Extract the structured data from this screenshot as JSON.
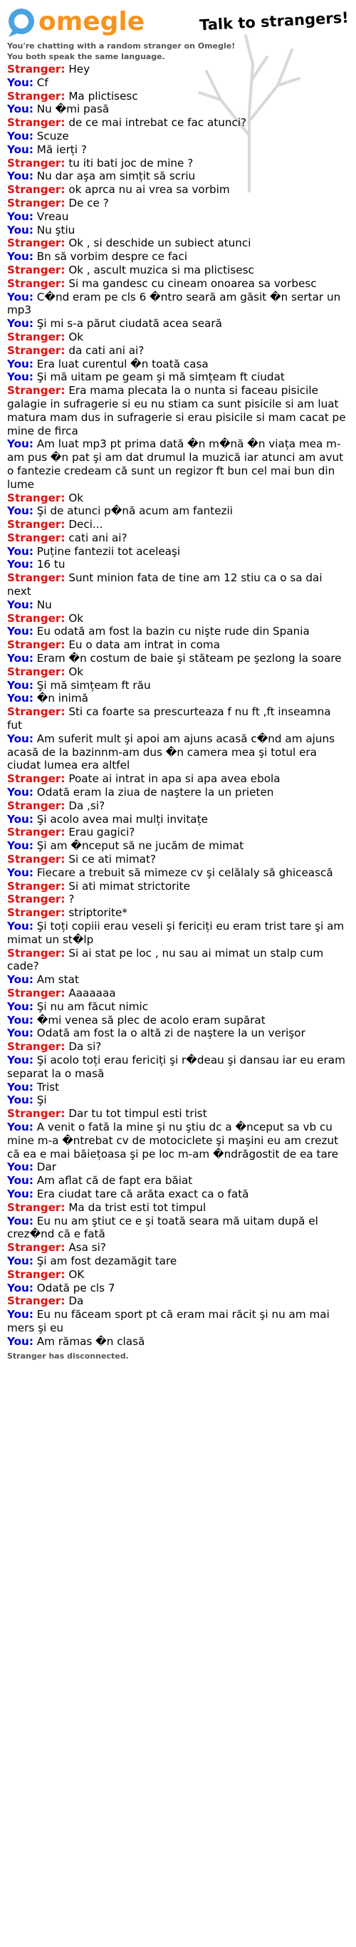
{
  "app": {
    "logo_text": "omegle",
    "tagline": "Talk to strangers!",
    "status_line1": "You're chatting with a random stranger on Omegle!",
    "status_line2": "You both speak the same language.",
    "disconnected": "Stranger has disconnected.",
    "colors": {
      "brand_orange": "#f7931e",
      "logo_blue": "#4aa3df",
      "stranger": "#dd1111",
      "you": "#0000d6"
    }
  },
  "speakers": {
    "stranger": "Stranger:",
    "you": "You:"
  },
  "messages": [
    {
      "from": "stranger",
      "text": "Hey"
    },
    {
      "from": "you",
      "text": "Cf"
    },
    {
      "from": "stranger",
      "text": "Ma plictisesc"
    },
    {
      "from": "you",
      "text": "Nu �mi pasă"
    },
    {
      "from": "stranger",
      "text": "de ce mai intrebat ce fac atunci?"
    },
    {
      "from": "you",
      "text": "Scuze"
    },
    {
      "from": "you",
      "text": "Mă ierți ?"
    },
    {
      "from": "stranger",
      "text": "tu iti bati joc de mine ?"
    },
    {
      "from": "you",
      "text": "Nu dar aşa am simțit să scriu"
    },
    {
      "from": "stranger",
      "text": "ok aprca nu ai vrea sa vorbim"
    },
    {
      "from": "stranger",
      "text": "De ce ?"
    },
    {
      "from": "you",
      "text": "Vreau"
    },
    {
      "from": "you",
      "text": "Nu ştiu"
    },
    {
      "from": "stranger",
      "text": "Ok , si deschide un subiect atunci"
    },
    {
      "from": "you",
      "text": "Bn să vorbim despre ce faci"
    },
    {
      "from": "stranger",
      "text": "Ok , ascult muzica si ma plictisesc"
    },
    {
      "from": "stranger",
      "text": "Si ma gandesc cu cineam onoarea sa vorbesc"
    },
    {
      "from": "you",
      "text": "C�nd eram pe cls 6 �ntro seară am găsit �n sertar un mp3"
    },
    {
      "from": "you",
      "text": "Şi mi s-a părut ciudată acea seară"
    },
    {
      "from": "stranger",
      "text": "Ok"
    },
    {
      "from": "stranger",
      "text": "da cati ani ai?"
    },
    {
      "from": "you",
      "text": "Era luat curentul �n toată casa"
    },
    {
      "from": "you",
      "text": "Şi mă uitam pe geam şi mă simțeam ft ciudat"
    },
    {
      "from": "stranger",
      "text": "Era mama plecata la o nunta si faceau pisicile galagie in sufragerie si eu nu stiam ca sunt pisicile si am luat matura mam dus in sufragerie si erau pisicile si mam cacat pe mine de firca"
    },
    {
      "from": "you",
      "text": "Am luat mp3 pt prima dată �n m�nă �n viața mea m-am pus �n pat şi am dat drumul la muzică iar atunci am avut o fantezie credeam că sunt un regizor ft bun cel mai bun din lume"
    },
    {
      "from": "stranger",
      "text": "Ok"
    },
    {
      "from": "you",
      "text": "Şi de atunci p�nă acum am fantezii"
    },
    {
      "from": "stranger",
      "text": "Deci..."
    },
    {
      "from": "stranger",
      "text": "cati ani ai?"
    },
    {
      "from": "you",
      "text": "Puține fantezii tot aceleaşi"
    },
    {
      "from": "you",
      "text": "16 tu"
    },
    {
      "from": "stranger",
      "text": "Sunt minion fata de tine am 12 stiu ca o sa dai next"
    },
    {
      "from": "you",
      "text": "Nu"
    },
    {
      "from": "stranger",
      "text": "Ok"
    },
    {
      "from": "you",
      "text": "Eu odată am fost la bazin cu nişte rude din Spania"
    },
    {
      "from": "stranger",
      "text": "Eu o data am intrat in coma"
    },
    {
      "from": "you",
      "text": "Eram �n costum de baie şi stăteam pe şezlong la soare"
    },
    {
      "from": "stranger",
      "text": "Ok"
    },
    {
      "from": "you",
      "text": "Şi mă simțeam ft rău"
    },
    {
      "from": "you",
      "text": "�n inimă"
    },
    {
      "from": "stranger",
      "text": "Sti ca foarte sa prescurteaza f nu ft ,ft inseamna fut"
    },
    {
      "from": "you",
      "text": "Am suferit mult şi apoi am ajuns acasă c�nd am ajuns acasă de la bazinnm-am dus �n camera mea şi totul era ciudat lumea era altfel"
    },
    {
      "from": "stranger",
      "text": "Poate ai intrat in apa si apa avea ebola"
    },
    {
      "from": "you",
      "text": "Odată eram la ziua de naştere la un prieten"
    },
    {
      "from": "stranger",
      "text": "Da ,si?"
    },
    {
      "from": "you",
      "text": "Şi acolo avea mai mulți invitațe"
    },
    {
      "from": "stranger",
      "text": "Erau gagici?"
    },
    {
      "from": "you",
      "text": "Şi am �nceput să ne jucăm de mimat"
    },
    {
      "from": "stranger",
      "text": "Si ce ati mimat?"
    },
    {
      "from": "you",
      "text": "Fiecare a trebuit să mimeze cv şi celălaly să ghicească"
    },
    {
      "from": "stranger",
      "text": "Si ati mimat strictorite"
    },
    {
      "from": "stranger",
      "text": "?"
    },
    {
      "from": "stranger",
      "text": "striptorite*"
    },
    {
      "from": "you",
      "text": "Şi toți copiii erau veseli şi fericiți eu eram trist tare şi am mimat un st�lp"
    },
    {
      "from": "stranger",
      "text": "Si ai stat pe loc , nu sau ai mimat un stalp cum cade?"
    },
    {
      "from": "you",
      "text": "Am stat"
    },
    {
      "from": "stranger",
      "text": "Aaaaaaa"
    },
    {
      "from": "you",
      "text": "Şi nu am făcut nimic"
    },
    {
      "from": "you",
      "text": "�mi venea să plec de acolo eram supărat"
    },
    {
      "from": "you",
      "text": "Odată am fost la o altă zi de naştere la un verişor"
    },
    {
      "from": "stranger",
      "text": "Da si?"
    },
    {
      "from": "you",
      "text": "Şi acolo toți erau fericiți şi r�deau şi dansau iar eu eram separat la o masă"
    },
    {
      "from": "you",
      "text": "Trist"
    },
    {
      "from": "you",
      "text": "Şi"
    },
    {
      "from": "stranger",
      "text": "Dar tu tot timpul esti trist"
    },
    {
      "from": "you",
      "text": "A venit o fată la mine şi nu ştiu dc a �nceput sa vb cu mine m-a �ntrebat cv de motociclete şi maşini eu am crezut că ea e mai băiețoasa şi pe loc m-am �ndrăgostit de ea tare"
    },
    {
      "from": "you",
      "text": "Dar"
    },
    {
      "from": "you",
      "text": "Am aflat că de fapt era băiat"
    },
    {
      "from": "you",
      "text": "Era ciudat tare că arăta exact ca o fată"
    },
    {
      "from": "stranger",
      "text": "Ma da trist esti tot timpul"
    },
    {
      "from": "you",
      "text": "Eu nu am ştiut ce e şi toată seara mă uitam după el crez�nd că e fată"
    },
    {
      "from": "stranger",
      "text": "Asa si?"
    },
    {
      "from": "you",
      "text": "Şi am fost dezamăgit tare"
    },
    {
      "from": "stranger",
      "text": "OK"
    },
    {
      "from": "you",
      "text": "Odată pe cls 7"
    },
    {
      "from": "stranger",
      "text": "Da"
    },
    {
      "from": "you",
      "text": "Eu nu făceam sport pt că eram mai răcit şi nu am mai mers şi eu"
    },
    {
      "from": "you",
      "text": "Am rămas �n clasă"
    }
  ]
}
